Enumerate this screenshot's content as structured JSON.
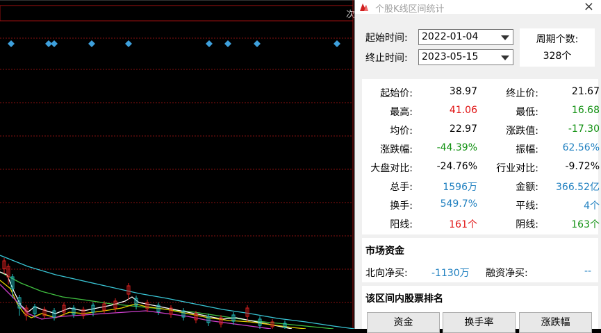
{
  "chart": {
    "top_right_label": "次",
    "diamond_color": "#3ea0dc",
    "grid_color": "#8a1010"
  },
  "dialog": {
    "title": "个股K线区间统计",
    "start_label": "起始时间:",
    "start_value": "2022-01-04",
    "end_label": "终止时间:",
    "end_value": "2023-05-15",
    "period_label": "周期个数:",
    "period_value": "328个",
    "stats": [
      {
        "k1": "起始价:",
        "v1": "38.97",
        "c1": "black",
        "k2": "终止价:",
        "v2": "21.67",
        "c2": "black"
      },
      {
        "k1": "最高:",
        "v1": "41.06",
        "c1": "red",
        "k2": "最低:",
        "v2": "16.68",
        "c2": "green"
      },
      {
        "k1": "均价:",
        "v1": "22.97",
        "c1": "black",
        "k2": "涨跌值:",
        "v2": "-17.30",
        "c2": "green"
      },
      {
        "k1": "涨跌幅:",
        "v1": "-44.39%",
        "c1": "green",
        "k2": "振幅:",
        "v2": "62.56%",
        "c2": "blue"
      },
      {
        "k1": "大盘对比:",
        "v1": "-24.76%",
        "c1": "black",
        "k2": "行业对比:",
        "v2": "-9.72%",
        "c2": "black"
      },
      {
        "k1": "总手:",
        "v1": "1596万",
        "c1": "blue",
        "k2": "金额:",
        "v2": "366.52亿",
        "c2": "blue"
      },
      {
        "k1": "换手:",
        "v1": "549.7%",
        "c1": "blue",
        "k2": "平线:",
        "v2": "4个",
        "c2": "blue"
      },
      {
        "k1": "阳线:",
        "v1": "161个",
        "c1": "red",
        "k2": "阴线:",
        "v2": "163个",
        "c2": "green"
      }
    ],
    "market_section_title": "市场资金",
    "northbound_label": "北向净买:",
    "northbound_value": "-1130万",
    "margin_label": "融资净买:",
    "margin_value": "--",
    "ranking_section_title": "该区间内股票排名",
    "buttons": [
      "资金",
      "换手率",
      "涨跌幅"
    ]
  }
}
